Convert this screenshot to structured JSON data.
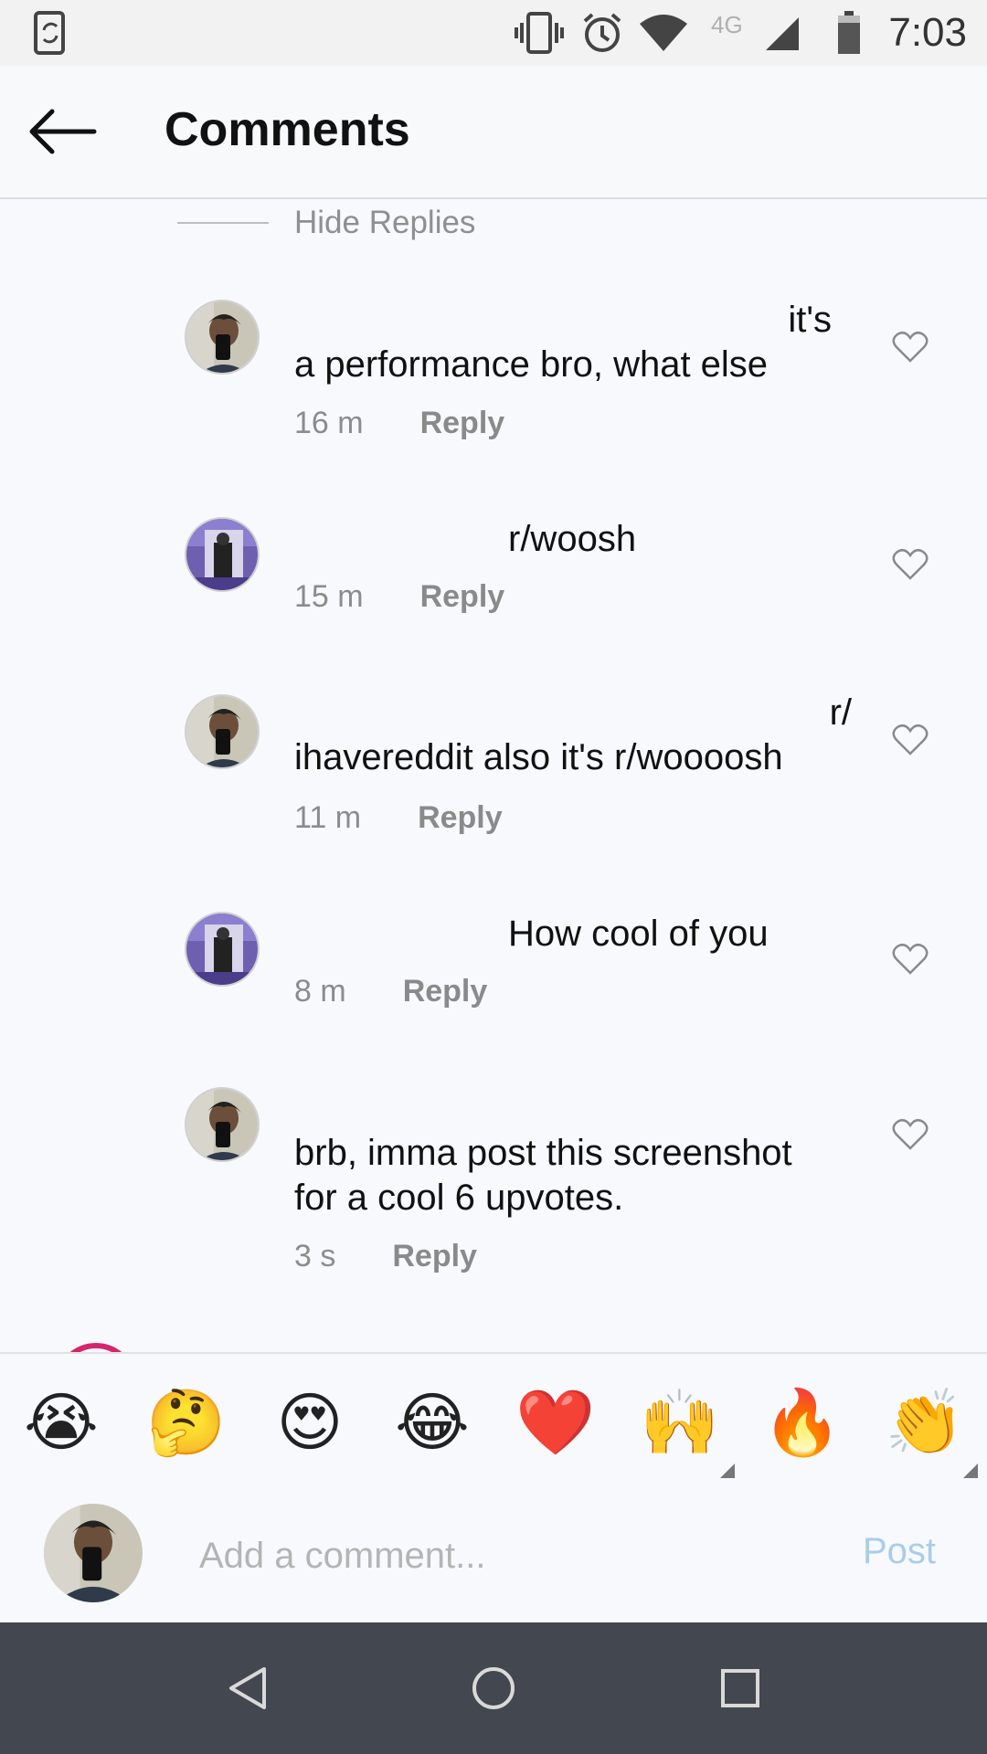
{
  "status_bar": {
    "time": "7:03",
    "network_label": "4G",
    "icons": [
      "sync-phone-icon",
      "vibrate-icon",
      "alarm-icon",
      "wifi-icon",
      "signal-icon",
      "battery-icon"
    ]
  },
  "header": {
    "title": "Comments",
    "back_icon": "arrow-left-icon"
  },
  "thread": {
    "hide_replies_label": "Hide Replies",
    "comments": [
      {
        "text_line1": "it's",
        "text_line2": "a performance bro, what else",
        "time": "16 m",
        "reply_label": "Reply",
        "avatar": "mirror-selfie-avatar"
      },
      {
        "text_line1": "r/woosh",
        "time": "15 m",
        "reply_label": "Reply",
        "avatar": "purple-room-avatar"
      },
      {
        "text_line1": "r/",
        "text_line2": "ihavereddit also it's r/woooosh",
        "time": "11 m",
        "reply_label": "Reply",
        "avatar": "mirror-selfie-avatar"
      },
      {
        "text_line1": "How cool of you",
        "time": "8 m",
        "reply_label": "Reply",
        "avatar": "purple-room-avatar"
      },
      {
        "text_line1": "brb, imma post this screenshot",
        "text_line2": "for a cool 6 upvotes.",
        "time": "3 s",
        "reply_label": "Reply",
        "avatar": "mirror-selfie-avatar"
      }
    ]
  },
  "emoji_bar": {
    "emojis": [
      "😭",
      "🤔",
      "😍",
      "😂",
      "❤️",
      "🙌",
      "🔥",
      "👏"
    ]
  },
  "compose": {
    "placeholder": "Add a comment...",
    "post_label": "Post"
  },
  "colors": {
    "accent_post": "#a9cde9",
    "nav_bar": "#43474f",
    "story_ring": "#d6246e"
  }
}
